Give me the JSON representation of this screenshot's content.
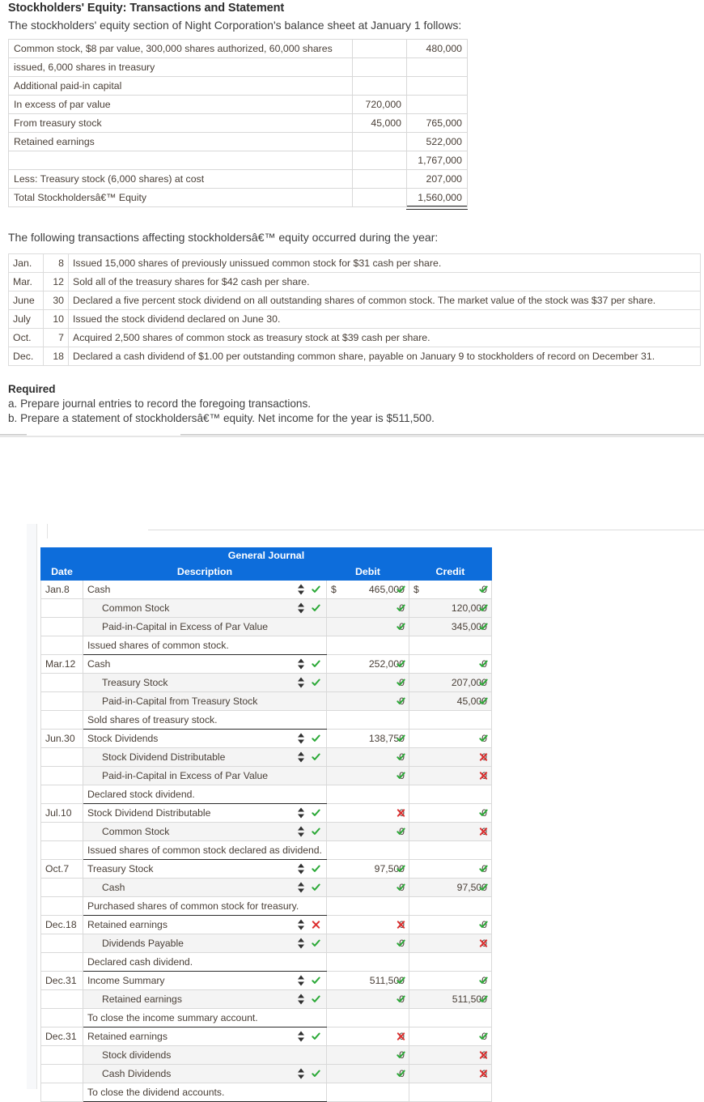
{
  "problem": {
    "title": "Stockholders' Equity: Transactions and Statement",
    "intro": "The stockholders' equity section of Night Corporation's balance sheet at January 1 follows:",
    "transactions_intro": "The following transactions affecting stockholdersâ€™ equity occurred during the year:",
    "required_heading": "Required",
    "required_a": "a. Prepare journal entries to record the foregoing transactions.",
    "required_b": "b. Prepare a statement of stockholdersâ€™ equity. Net income for the year is $511,500."
  },
  "balance_sheet": {
    "rows": [
      {
        "label": "Common stock, $8 par value, 300,000 shares authorized, 60,000 shares",
        "c1": "",
        "c2": "480,000"
      },
      {
        "label": "issued, 6,000 shares in treasury",
        "c1": "",
        "c2": ""
      },
      {
        "label": "Additional paid-in capital",
        "c1": "",
        "c2": ""
      },
      {
        "label": "In excess of par value",
        "c1": "720,000",
        "c2": ""
      },
      {
        "label": "From treasury stock",
        "c1": "45,000",
        "c2": "765,000"
      },
      {
        "label": "Retained earnings",
        "c1": "",
        "c2": "522,000"
      },
      {
        "label": "",
        "c1": "",
        "c2": "1,767,000"
      },
      {
        "label": "Less: Treasury stock (6,000 shares) at cost",
        "c1": "",
        "c2": "207,000"
      },
      {
        "label": "Total Stockholdersâ€™ Equity",
        "c1": "",
        "c2": "1,560,000"
      }
    ]
  },
  "transactions": {
    "rows": [
      {
        "month": "Jan.",
        "day": "8",
        "description": "Issued 15,000 shares of previously unissued common stock for $31 cash per share."
      },
      {
        "month": "Mar.",
        "day": "12",
        "description": "Sold all of the treasury shares for $42 cash per share."
      },
      {
        "month": "June",
        "day": "30",
        "description": "Declared a five percent stock dividend on all outstanding shares of common stock. The market value of the stock was $37 per share."
      },
      {
        "month": "July",
        "day": "10",
        "description": "Issued the stock dividend declared on June 30."
      },
      {
        "month": "Oct.",
        "day": "7",
        "description": "Acquired 2,500 shares of common stock as treasury stock at $39 cash per share."
      },
      {
        "month": "Dec.",
        "day": "18",
        "description": "Declared a cash dividend of $1.00 per outstanding common share, payable on January 9 to stockholders of record on December 31."
      }
    ]
  },
  "journal": {
    "title": "General Journal",
    "columns": {
      "date": "Date",
      "description": "Description",
      "debit": "Debit",
      "credit": "Credit"
    },
    "currency_symbol": "$",
    "accent_color": "#0d6ddb",
    "ok_color": "#2aa836",
    "bad_color": "#dd2f2f",
    "rows": [
      {
        "date": "Jan.8",
        "desc": "Cash",
        "indent": 0,
        "stepper": true,
        "desc_mark": "ok",
        "show_dollar": true,
        "debit": "465,000",
        "debit_mark": "ok",
        "credit": "0",
        "credit_mark": "ok",
        "group_start": true
      },
      {
        "date": "",
        "desc": "Common Stock",
        "indent": 1,
        "stepper": true,
        "desc_mark": "ok",
        "debit": "0",
        "debit_mark": "ok",
        "credit": "120,000",
        "credit_mark": "ok",
        "alt": true
      },
      {
        "date": "",
        "desc": "Paid-in-Capital in Excess of Par Value",
        "indent": 1,
        "stepper": false,
        "desc_mark": "none",
        "debit": "0",
        "debit_mark": "ok",
        "credit": "345,000",
        "credit_mark": "ok",
        "alt": true
      },
      {
        "date": "",
        "desc": "Issued shares of common stock.",
        "indent": 0,
        "stepper": false,
        "desc_mark": "none",
        "debit": "",
        "debit_mark": "none",
        "credit": "",
        "credit_mark": "none",
        "memo": true
      },
      {
        "date": "Mar.12",
        "desc": "Cash",
        "indent": 0,
        "stepper": true,
        "desc_mark": "ok",
        "debit": "252,000",
        "debit_mark": "ok",
        "credit": "0",
        "credit_mark": "ok",
        "group_start": true
      },
      {
        "date": "",
        "desc": "Treasury Stock",
        "indent": 1,
        "stepper": true,
        "desc_mark": "ok",
        "debit": "0",
        "debit_mark": "ok",
        "credit": "207,000",
        "credit_mark": "ok",
        "alt": true
      },
      {
        "date": "",
        "desc": "Paid-in-Capital from Treasury Stock",
        "indent": 1,
        "stepper": false,
        "desc_mark": "none",
        "debit": "0",
        "debit_mark": "ok",
        "credit": "45,000",
        "credit_mark": "ok",
        "alt": true
      },
      {
        "date": "",
        "desc": "Sold shares of treasury stock.",
        "indent": 0,
        "stepper": false,
        "desc_mark": "none",
        "debit": "",
        "debit_mark": "none",
        "credit": "",
        "credit_mark": "none",
        "memo": true
      },
      {
        "date": "Jun.30",
        "desc": "Stock Dividends",
        "indent": 0,
        "stepper": true,
        "desc_mark": "ok",
        "debit": "138,750",
        "debit_mark": "ok",
        "credit": "0",
        "credit_mark": "ok",
        "group_start": true
      },
      {
        "date": "",
        "desc": "Stock Dividend Distributable",
        "indent": 1,
        "stepper": true,
        "desc_mark": "ok",
        "debit": "0",
        "debit_mark": "ok",
        "credit": "0",
        "credit_mark": "bad",
        "alt": true
      },
      {
        "date": "",
        "desc": "Paid-in-Capital in Excess of Par Value",
        "indent": 1,
        "stepper": false,
        "desc_mark": "none",
        "debit": "0",
        "debit_mark": "ok",
        "credit": "0",
        "credit_mark": "bad",
        "alt": true
      },
      {
        "date": "",
        "desc": "Declared stock dividend.",
        "indent": 0,
        "stepper": false,
        "desc_mark": "none",
        "debit": "",
        "debit_mark": "none",
        "credit": "",
        "credit_mark": "none",
        "memo": true
      },
      {
        "date": "Jul.10",
        "desc": "Stock Dividend Distributable",
        "indent": 0,
        "stepper": true,
        "desc_mark": "ok",
        "debit": "0",
        "debit_mark": "bad",
        "credit": "0",
        "credit_mark": "ok",
        "group_start": true
      },
      {
        "date": "",
        "desc": "Common Stock",
        "indent": 1,
        "stepper": true,
        "desc_mark": "ok",
        "debit": "0",
        "debit_mark": "ok",
        "credit": "0",
        "credit_mark": "bad",
        "alt": true
      },
      {
        "date": "",
        "desc": "Issued shares of common stock declared as dividend.",
        "indent": 0,
        "stepper": false,
        "desc_mark": "none",
        "debit": "",
        "debit_mark": "none",
        "credit": "",
        "credit_mark": "none",
        "memo": true
      },
      {
        "date": "Oct.7",
        "desc": "Treasury Stock",
        "indent": 0,
        "stepper": true,
        "desc_mark": "ok",
        "debit": "97,500",
        "debit_mark": "ok",
        "credit": "0",
        "credit_mark": "ok",
        "group_start": true
      },
      {
        "date": "",
        "desc": "Cash",
        "indent": 1,
        "stepper": true,
        "desc_mark": "ok",
        "debit": "0",
        "debit_mark": "ok",
        "credit": "97,500",
        "credit_mark": "ok",
        "alt": true
      },
      {
        "date": "",
        "desc": "Purchased shares of common stock for treasury.",
        "indent": 0,
        "stepper": false,
        "desc_mark": "none",
        "debit": "",
        "debit_mark": "none",
        "credit": "",
        "credit_mark": "none",
        "memo": true
      },
      {
        "date": "Dec.18",
        "desc": "Retained earnings",
        "indent": 0,
        "stepper": true,
        "desc_mark": "bad",
        "debit": "0",
        "debit_mark": "bad",
        "credit": "0",
        "credit_mark": "ok",
        "group_start": true
      },
      {
        "date": "",
        "desc": "Dividends Payable",
        "indent": 1,
        "stepper": true,
        "desc_mark": "ok",
        "debit": "0",
        "debit_mark": "ok",
        "credit": "0",
        "credit_mark": "bad",
        "alt": true
      },
      {
        "date": "",
        "desc": "Declared cash dividend.",
        "indent": 0,
        "stepper": false,
        "desc_mark": "none",
        "debit": "",
        "debit_mark": "none",
        "credit": "",
        "credit_mark": "none",
        "memo": true
      },
      {
        "date": "Dec.31",
        "desc": "Income Summary",
        "indent": 0,
        "stepper": true,
        "desc_mark": "ok",
        "debit": "511,500",
        "debit_mark": "ok",
        "credit": "0",
        "credit_mark": "ok",
        "group_start": true
      },
      {
        "date": "",
        "desc": "Retained earnings",
        "indent": 1,
        "stepper": true,
        "desc_mark": "ok",
        "debit": "0",
        "debit_mark": "ok",
        "credit": "511,500",
        "credit_mark": "ok",
        "alt": true
      },
      {
        "date": "",
        "desc": "To close the income summary account.",
        "indent": 0,
        "stepper": false,
        "desc_mark": "none",
        "debit": "",
        "debit_mark": "none",
        "credit": "",
        "credit_mark": "none",
        "memo": true
      },
      {
        "date": "Dec.31",
        "desc": "Retained earnings",
        "indent": 0,
        "stepper": true,
        "desc_mark": "ok",
        "debit": "0",
        "debit_mark": "bad",
        "credit": "0",
        "credit_mark": "ok",
        "group_start": true
      },
      {
        "date": "",
        "desc": "Stock dividends",
        "indent": 1,
        "stepper": false,
        "desc_mark": "none",
        "debit": "0",
        "debit_mark": "ok",
        "credit": "0",
        "credit_mark": "bad",
        "alt": true
      },
      {
        "date": "",
        "desc": "Cash Dividends",
        "indent": 1,
        "stepper": true,
        "desc_mark": "ok",
        "debit": "0",
        "debit_mark": "ok",
        "credit": "0",
        "credit_mark": "bad",
        "alt": true
      },
      {
        "date": "",
        "desc": "To close the dividend accounts.",
        "indent": 0,
        "stepper": false,
        "desc_mark": "none",
        "debit": "",
        "debit_mark": "none",
        "credit": "",
        "credit_mark": "none",
        "memo": true
      }
    ]
  }
}
